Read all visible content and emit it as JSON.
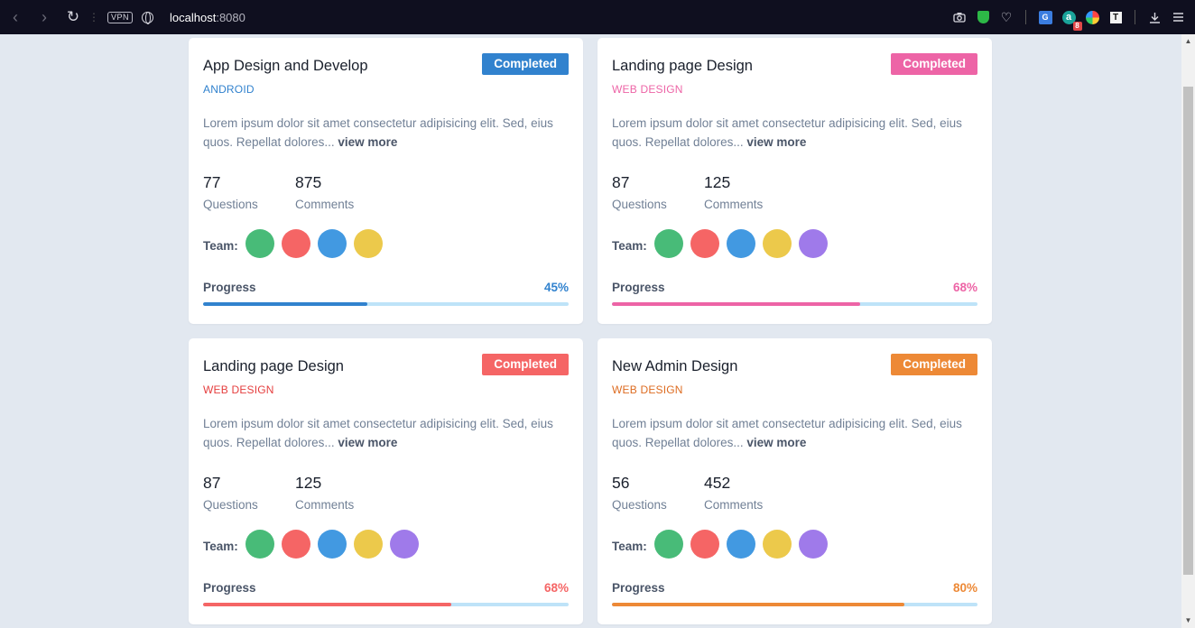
{
  "browser": {
    "url_host": "localhost",
    "url_port": ":8080",
    "vpn_label": "VPN",
    "icons": [
      "back-icon",
      "forward-icon",
      "reload-icon",
      "camera-icon",
      "shield-extension-icon",
      "heart-icon",
      "translate-extension-icon",
      "a-extension-icon",
      "color-picker-extension-icon",
      "t-extension-icon",
      "download-icon",
      "menu-icon"
    ],
    "ext_badge": "8"
  },
  "cards": [
    {
      "title": "App Design and Develop",
      "badge": "Completed",
      "category": "ANDROID",
      "description": "Lorem ipsum dolor sit amet consectetur adipisicing elit. Sed, eius quos. Repellat dolores...",
      "view_more": "view more",
      "questions_value": "77",
      "questions_label": "Questions",
      "comments_value": "875",
      "comments_label": "Comments",
      "team_label": "Team:",
      "team_colors": [
        "#48bb78",
        "#f56565",
        "#4299e1",
        "#ecc94b"
      ],
      "progress_label": "Progress",
      "progress_text": "45%",
      "progress": 0.45,
      "accent": "#3182ce",
      "category_color": "#3182ce"
    },
    {
      "title": "Landing page Design",
      "badge": "Completed",
      "category": "WEB DESIGN",
      "description": "Lorem ipsum dolor sit amet consectetur adipisicing elit. Sed, eius quos. Repellat dolores...",
      "view_more": "view more",
      "questions_value": "87",
      "questions_label": "Questions",
      "comments_value": "125",
      "comments_label": "Comments",
      "team_label": "Team:",
      "team_colors": [
        "#48bb78",
        "#f56565",
        "#4299e1",
        "#ecc94b",
        "#9f7aea"
      ],
      "progress_label": "Progress",
      "progress_text": "68%",
      "progress": 0.68,
      "accent": "#ed64a6",
      "category_color": "#ed64a6"
    },
    {
      "title": "Landing page Design",
      "badge": "Completed",
      "category": "WEB DESIGN",
      "description": "Lorem ipsum dolor sit amet consectetur adipisicing elit. Sed, eius quos. Repellat dolores...",
      "view_more": "view more",
      "questions_value": "87",
      "questions_label": "Questions",
      "comments_value": "125",
      "comments_label": "Comments",
      "team_label": "Team:",
      "team_colors": [
        "#48bb78",
        "#f56565",
        "#4299e1",
        "#ecc94b",
        "#9f7aea"
      ],
      "progress_label": "Progress",
      "progress_text": "68%",
      "progress": 0.68,
      "accent": "#f56565",
      "category_color": "#e53e3e"
    },
    {
      "title": "New Admin Design",
      "badge": "Completed",
      "category": "WEB DESIGN",
      "description": "Lorem ipsum dolor sit amet consectetur adipisicing elit. Sed, eius quos. Repellat dolores...",
      "view_more": "view more",
      "questions_value": "56",
      "questions_label": "Questions",
      "comments_value": "452",
      "comments_label": "Comments",
      "team_label": "Team:",
      "team_colors": [
        "#48bb78",
        "#f56565",
        "#4299e1",
        "#ecc94b",
        "#9f7aea"
      ],
      "progress_label": "Progress",
      "progress_text": "80%",
      "progress": 0.8,
      "accent": "#ed8936",
      "category_color": "#dd6b20"
    }
  ]
}
